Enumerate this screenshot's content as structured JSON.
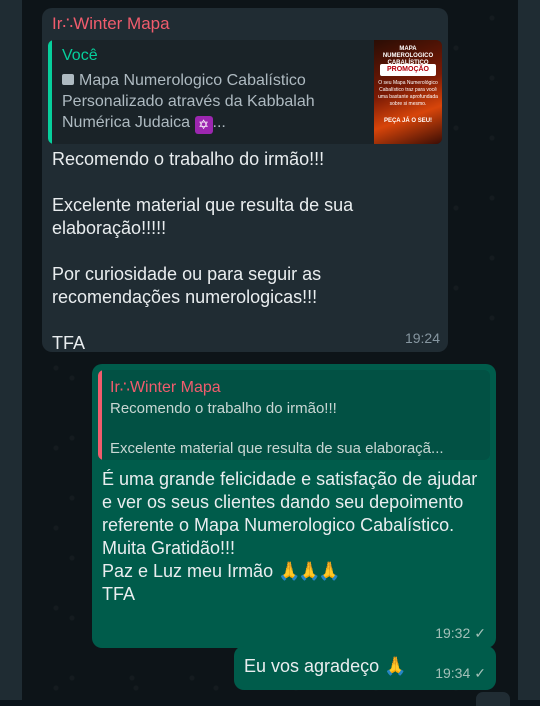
{
  "incoming": {
    "sender": "Ir∴Winter Mapa",
    "quote": {
      "author": "Você",
      "text": "Mapa Numerologico Cabalístico Personalizado através da Kabbalah Numérica Judaica",
      "ellipsis": "...",
      "thumbnail": {
        "title": "MAPA NUMEROLOGICO CABALÍSTICO",
        "badge": "PROMOÇÃO",
        "body": "O seu Mapa Numerológico Cabalístico traz para você uma bastante aprofundada sobre si mesmo.",
        "cta": "PEÇA JÁ O SEU!"
      }
    },
    "paragraphs": [
      "Recomendo o trabalho do irmão!!!",
      "Excelente material que resulta de sua elaboração!!!!!",
      "Por curiosidade ou para seguir as recomendações numerologicas!!!",
      "TFA"
    ],
    "time": "19:24"
  },
  "outgoing": {
    "quote": {
      "author": "Ir∴Winter Mapa",
      "line1": "Recomendo o trabalho do irmão!!!",
      "line2": "Excelente material que resulta de sua elaboraçã..."
    },
    "lines": [
      "É uma grande  felicidade e satisfação de ajudar e ver os seus clientes dando seu depoimento referente o Mapa Numerologico Cabalístico.",
      "Muita Gratidão!!!",
      "Paz e Luz meu Irmão",
      "TFA"
    ],
    "time": "19:32"
  },
  "outgoing2": {
    "text": "Eu vos agradeço",
    "time": "19:34"
  },
  "icons": {
    "pray": "🙏",
    "check": "✓",
    "star": "✡"
  }
}
